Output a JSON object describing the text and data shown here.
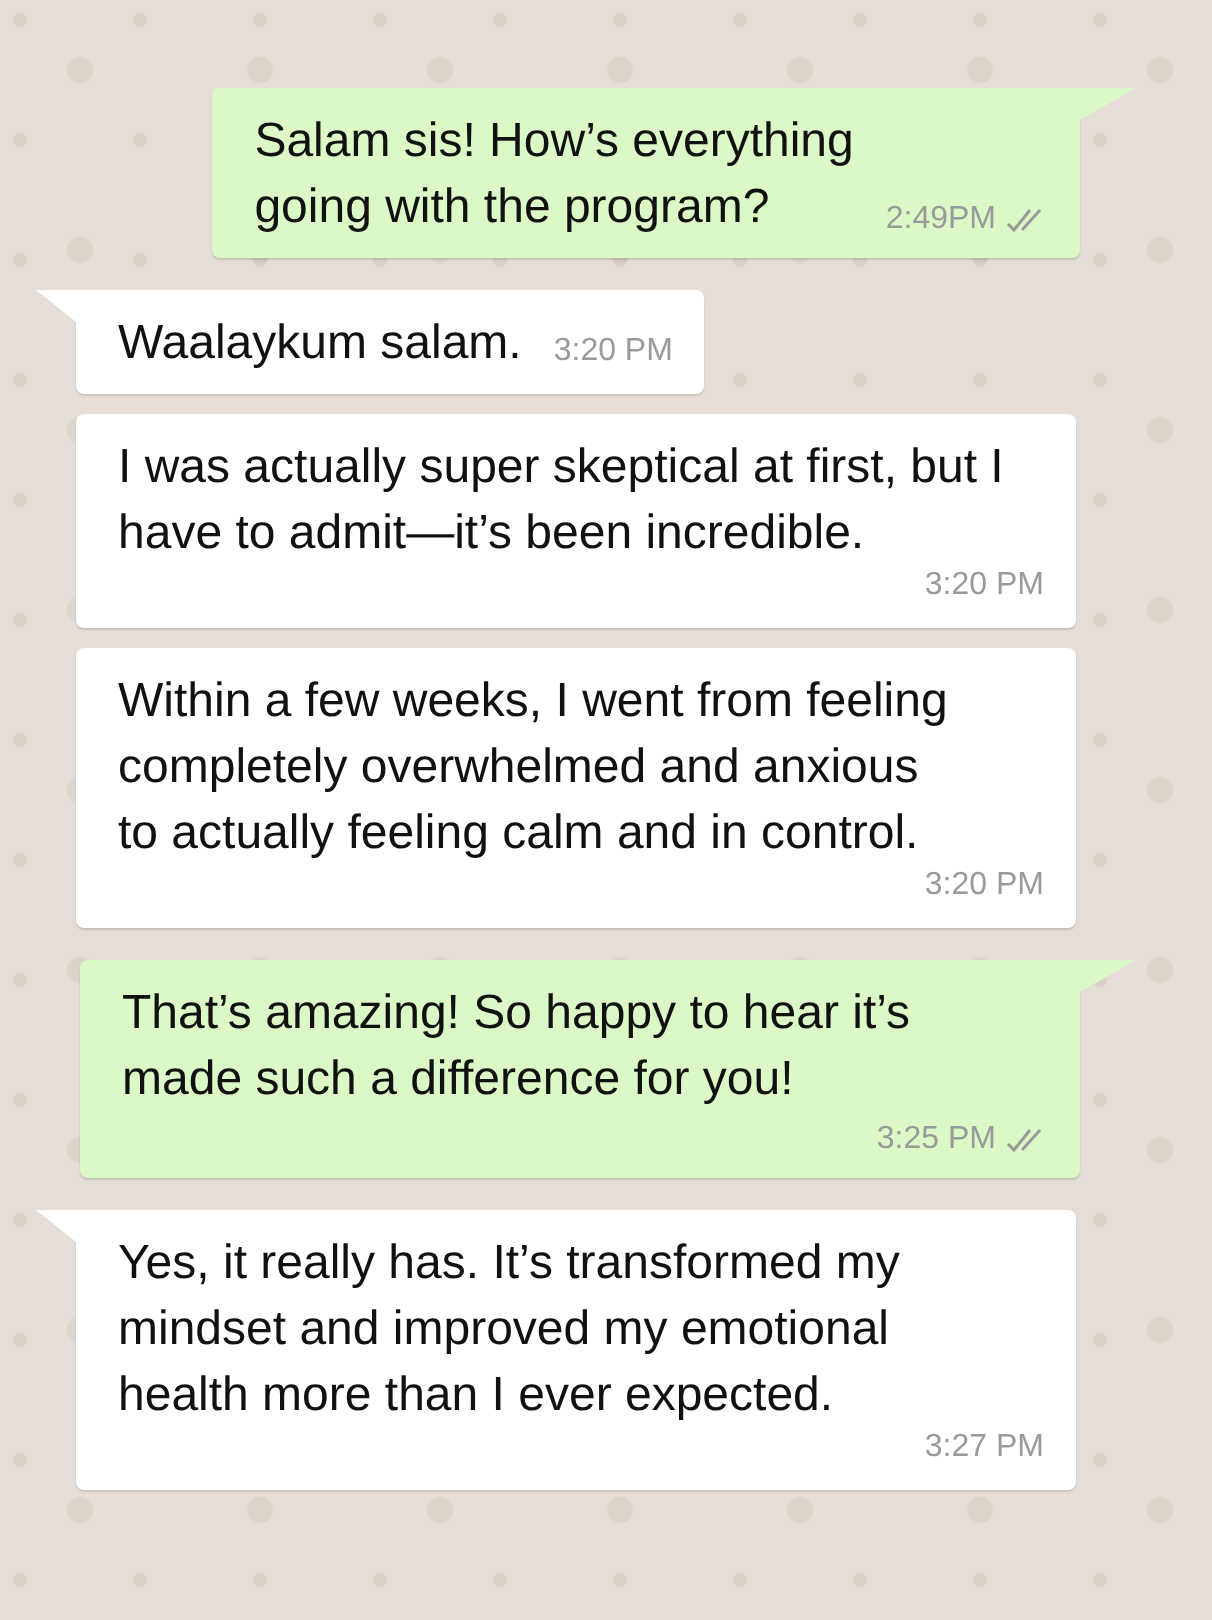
{
  "messages": [
    {
      "outgoing": true,
      "tail": true,
      "text": "Salam sis! How’s everything\ngoing with the program?",
      "time": "2:49PM",
      "delivered": true
    },
    {
      "outgoing": false,
      "tail": true,
      "text": "Waalaykum salam.",
      "time": "3:20 PM"
    },
    {
      "outgoing": false,
      "tail": false,
      "text": "I was actually super skeptical at first, but I\nhave to admit—it’s been incredible.",
      "time": "3:20 PM"
    },
    {
      "outgoing": false,
      "tail": false,
      "text": "Within a few weeks, I went from feeling\ncompletely overwhelmed and anxious\nto actually feeling calm and in control.",
      "time": "3:20 PM"
    },
    {
      "outgoing": true,
      "tail": true,
      "text": "That’s amazing! So happy to hear it’s\nmade such a difference for you!",
      "time": "3:25 PM",
      "delivered": true
    },
    {
      "outgoing": false,
      "tail": true,
      "text": "Yes, it really has. It’s transformed my\nmindset and improved my emotional\nhealth more than I ever expected.",
      "time": "3:27 PM"
    }
  ]
}
